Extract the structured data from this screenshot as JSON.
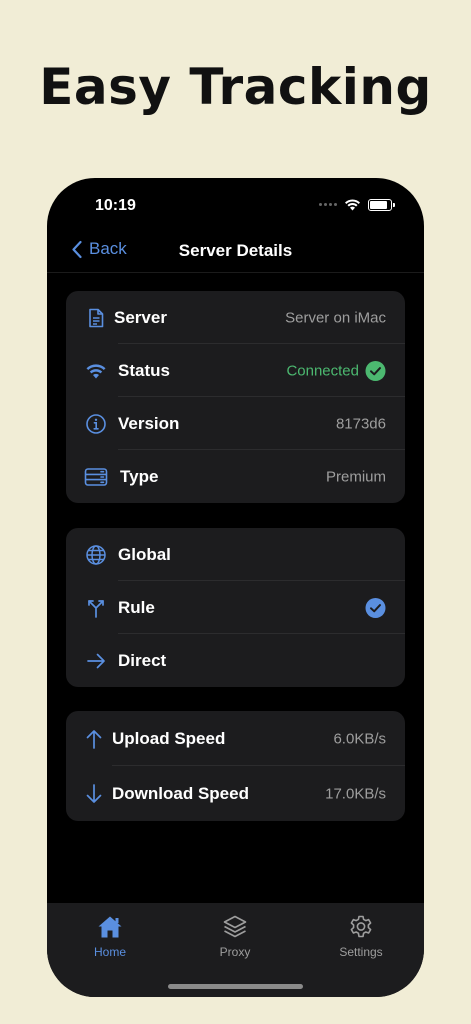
{
  "headline": "Easy Tracking",
  "status_bar": {
    "time": "10:19"
  },
  "nav": {
    "back_label": "Back",
    "title": "Server Details"
  },
  "server_info": [
    {
      "icon": "document-icon",
      "label": "Server",
      "value": "Server on iMac"
    },
    {
      "icon": "wifi-icon",
      "label": "Status",
      "value": "Connected",
      "value_color": "#4cb870"
    },
    {
      "icon": "info-icon",
      "label": "Version",
      "value": "8173d6"
    },
    {
      "icon": "server-icon",
      "label": "Type",
      "value": "Premium"
    }
  ],
  "modes": [
    {
      "icon": "globe-icon",
      "label": "Global",
      "selected": false
    },
    {
      "icon": "branch-icon",
      "label": "Rule",
      "selected": true
    },
    {
      "icon": "arrow-right-icon",
      "label": "Direct",
      "selected": false
    }
  ],
  "speeds": [
    {
      "icon": "arrow-up-icon",
      "label": "Upload Speed",
      "value": "6.0KB/s"
    },
    {
      "icon": "arrow-down-icon",
      "label": "Download Speed",
      "value": "17.0KB/s"
    }
  ],
  "tabs": [
    {
      "icon": "home-icon",
      "label": "Home",
      "active": true
    },
    {
      "icon": "layers-icon",
      "label": "Proxy",
      "active": false
    },
    {
      "icon": "gear-icon",
      "label": "Settings",
      "active": false
    }
  ],
  "colors": {
    "background": "#f1edd6",
    "accent": "#5a8fe0",
    "success": "#4cb870",
    "card": "#1c1c1e"
  }
}
